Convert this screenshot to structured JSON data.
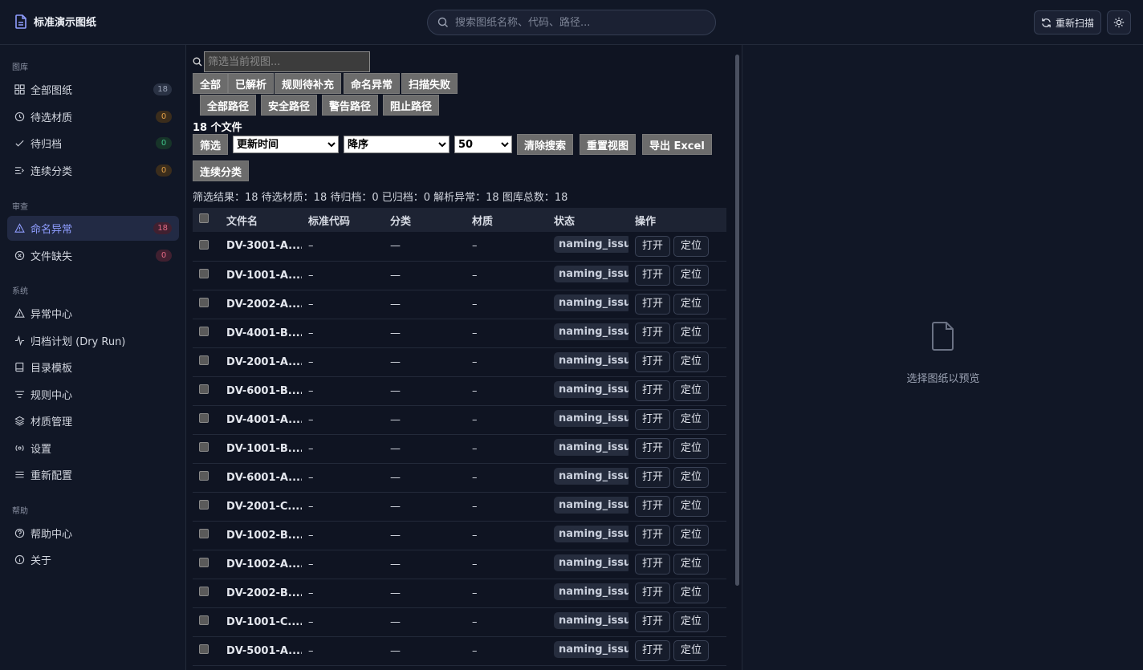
{
  "header": {
    "app_title": "标准演示图纸",
    "search_placeholder": "搜索图纸名称、代码、路径...",
    "rescan_label": "重新扫描"
  },
  "sidebar": {
    "sections": [
      {
        "title": "图库"
      },
      {
        "title": "审查"
      },
      {
        "title": "系统"
      },
      {
        "title": "帮助"
      }
    ],
    "items": [
      {
        "label": "全部图纸",
        "badge": "18",
        "icon": "grid-icon"
      },
      {
        "label": "待选材质",
        "badge": "0",
        "icon": "clock-icon"
      },
      {
        "label": "待归档",
        "badge": "0",
        "icon": "check-icon"
      },
      {
        "label": "连续分类",
        "badge": "0",
        "icon": "list-indent-icon"
      },
      {
        "label": "命名异常",
        "badge": "18",
        "icon": "warning-icon",
        "active": true
      },
      {
        "label": "文件缺失",
        "badge": "0",
        "icon": "x-circle-icon"
      },
      {
        "label": "异常中心",
        "icon": "warning-icon"
      },
      {
        "label": "归档计划 (Dry Run)",
        "icon": "activity-icon"
      },
      {
        "label": "目录模板",
        "icon": "book-icon"
      },
      {
        "label": "规则中心",
        "icon": "filter-icon"
      },
      {
        "label": "材质管理",
        "icon": "layers-icon"
      },
      {
        "label": "设置",
        "icon": "settings-icon"
      },
      {
        "label": "重新配置",
        "icon": "menu-icon"
      },
      {
        "label": "帮助中心",
        "icon": "help-circle-icon"
      },
      {
        "label": "关于",
        "icon": "info-icon"
      }
    ]
  },
  "main": {
    "filter_placeholder": "筛选当前视图...",
    "status_filters": [
      "全部",
      "已解析",
      "规则待补充",
      "命名异常",
      "扫描失败"
    ],
    "path_filters": [
      "全部路径",
      "安全路径",
      "警告路径",
      "阻止路径"
    ],
    "file_count": "18 个文件",
    "filter_button": "筛选",
    "sort_field": "更新时间",
    "sort_order": "降序",
    "page_size": "50",
    "clear_search": "清除搜索",
    "reset_view": "重置视图",
    "export_excel": "导出 Excel",
    "continuous_classify": "连续分类",
    "stats": "筛选结果：18  待选材质：18  待归档：0  已归档：0  解析异常：18  图库总数：18",
    "columns": [
      "文件名",
      "标准代码",
      "分类",
      "材质",
      "状态",
      "操作"
    ],
    "open_label": "打开",
    "locate_label": "定位",
    "rows": [
      {
        "name": "DV-3001-A....",
        "code": "–",
        "category": "—",
        "material": "–",
        "status": "naming_issue"
      },
      {
        "name": "DV-1001-A....",
        "code": "–",
        "category": "—",
        "material": "–",
        "status": "naming_issue"
      },
      {
        "name": "DV-2002-A....",
        "code": "–",
        "category": "—",
        "material": "–",
        "status": "naming_issue"
      },
      {
        "name": "DV-4001-B....",
        "code": "–",
        "category": "—",
        "material": "–",
        "status": "naming_issue"
      },
      {
        "name": "DV-2001-A....",
        "code": "–",
        "category": "—",
        "material": "–",
        "status": "naming_issue"
      },
      {
        "name": "DV-6001-B....",
        "code": "–",
        "category": "—",
        "material": "–",
        "status": "naming_issue"
      },
      {
        "name": "DV-4001-A....",
        "code": "–",
        "category": "—",
        "material": "–",
        "status": "naming_issue"
      },
      {
        "name": "DV-1001-B....",
        "code": "–",
        "category": "—",
        "material": "–",
        "status": "naming_issue"
      },
      {
        "name": "DV-6001-A....",
        "code": "–",
        "category": "—",
        "material": "–",
        "status": "naming_issue"
      },
      {
        "name": "DV-2001-C....",
        "code": "–",
        "category": "—",
        "material": "–",
        "status": "naming_issue"
      },
      {
        "name": "DV-1002-B....",
        "code": "–",
        "category": "—",
        "material": "–",
        "status": "naming_issue"
      },
      {
        "name": "DV-1002-A....",
        "code": "–",
        "category": "—",
        "material": "–",
        "status": "naming_issue"
      },
      {
        "name": "DV-2002-B....",
        "code": "–",
        "category": "—",
        "material": "–",
        "status": "naming_issue"
      },
      {
        "name": "DV-1001-C....",
        "code": "–",
        "category": "—",
        "material": "–",
        "status": "naming_issue"
      },
      {
        "name": "DV-5001-A....",
        "code": "–",
        "category": "—",
        "material": "–",
        "status": "naming_issue"
      }
    ]
  },
  "preview": {
    "empty_text": "选择图纸以预览"
  },
  "colors": {
    "accent": "#8f9dff",
    "background": "#0f1422",
    "panel": "#111726"
  }
}
